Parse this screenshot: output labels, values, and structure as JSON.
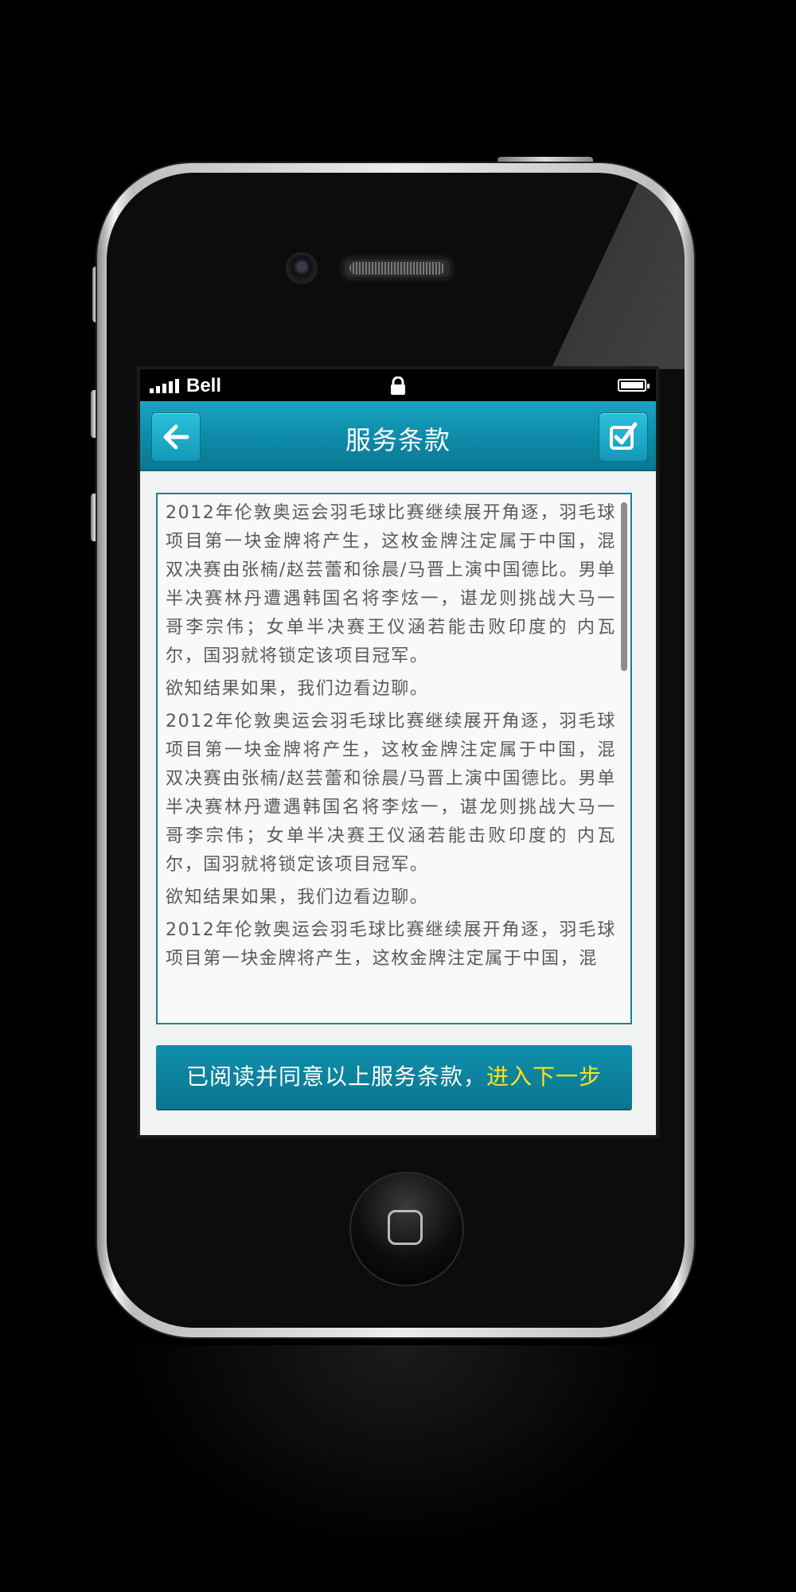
{
  "status_bar": {
    "carrier": "Bell",
    "signal_bars": 5,
    "icons": [
      "signal-icon",
      "lock-icon",
      "battery-icon"
    ]
  },
  "header": {
    "title": "服务条款",
    "back_icon": "arrow-left-icon",
    "confirm_icon": "checkbox-check-icon"
  },
  "terms": {
    "paragraphs": [
      "2012年伦敦奥运会羽毛球比赛继续展开角逐，羽毛球项目第一块金牌将产生，这枚金牌注定属于中国，混双决赛由张楠/赵芸蕾和徐晨/马晋上演中国德比。男单半决赛林丹遭遇韩国名将李炫一，谌龙则挑战大马一哥李宗伟；女单半决赛王仪涵若能击败印度的 内瓦尔，国羽就将锁定该项目冠军。",
      "欲知结果如果，我们边看边聊。",
      "2012年伦敦奥运会羽毛球比赛继续展开角逐，羽毛球项目第一块金牌将产生，这枚金牌注定属于中国，混双决赛由张楠/赵芸蕾和徐晨/马晋上演中国德比。男单半决赛林丹遭遇韩国名将李炫一，谌龙则挑战大马一哥李宗伟；女单半决赛王仪涵若能击败印度的 内瓦尔，国羽就将锁定该项目冠军。",
      "欲知结果如果，我们边看边聊。",
      "2012年伦敦奥运会羽毛球比赛继续展开角逐，羽毛球项目第一块金牌将产生，这枚金牌注定属于中国，混"
    ]
  },
  "agree_button": {
    "text": "已阅读并同意以上服务条款，",
    "highlight": "进入下一步"
  },
  "colors": {
    "header": "#0d8aa7",
    "button": "#0b7e99",
    "highlight": "#ffe21a",
    "body_text": "#5a5a5a"
  }
}
